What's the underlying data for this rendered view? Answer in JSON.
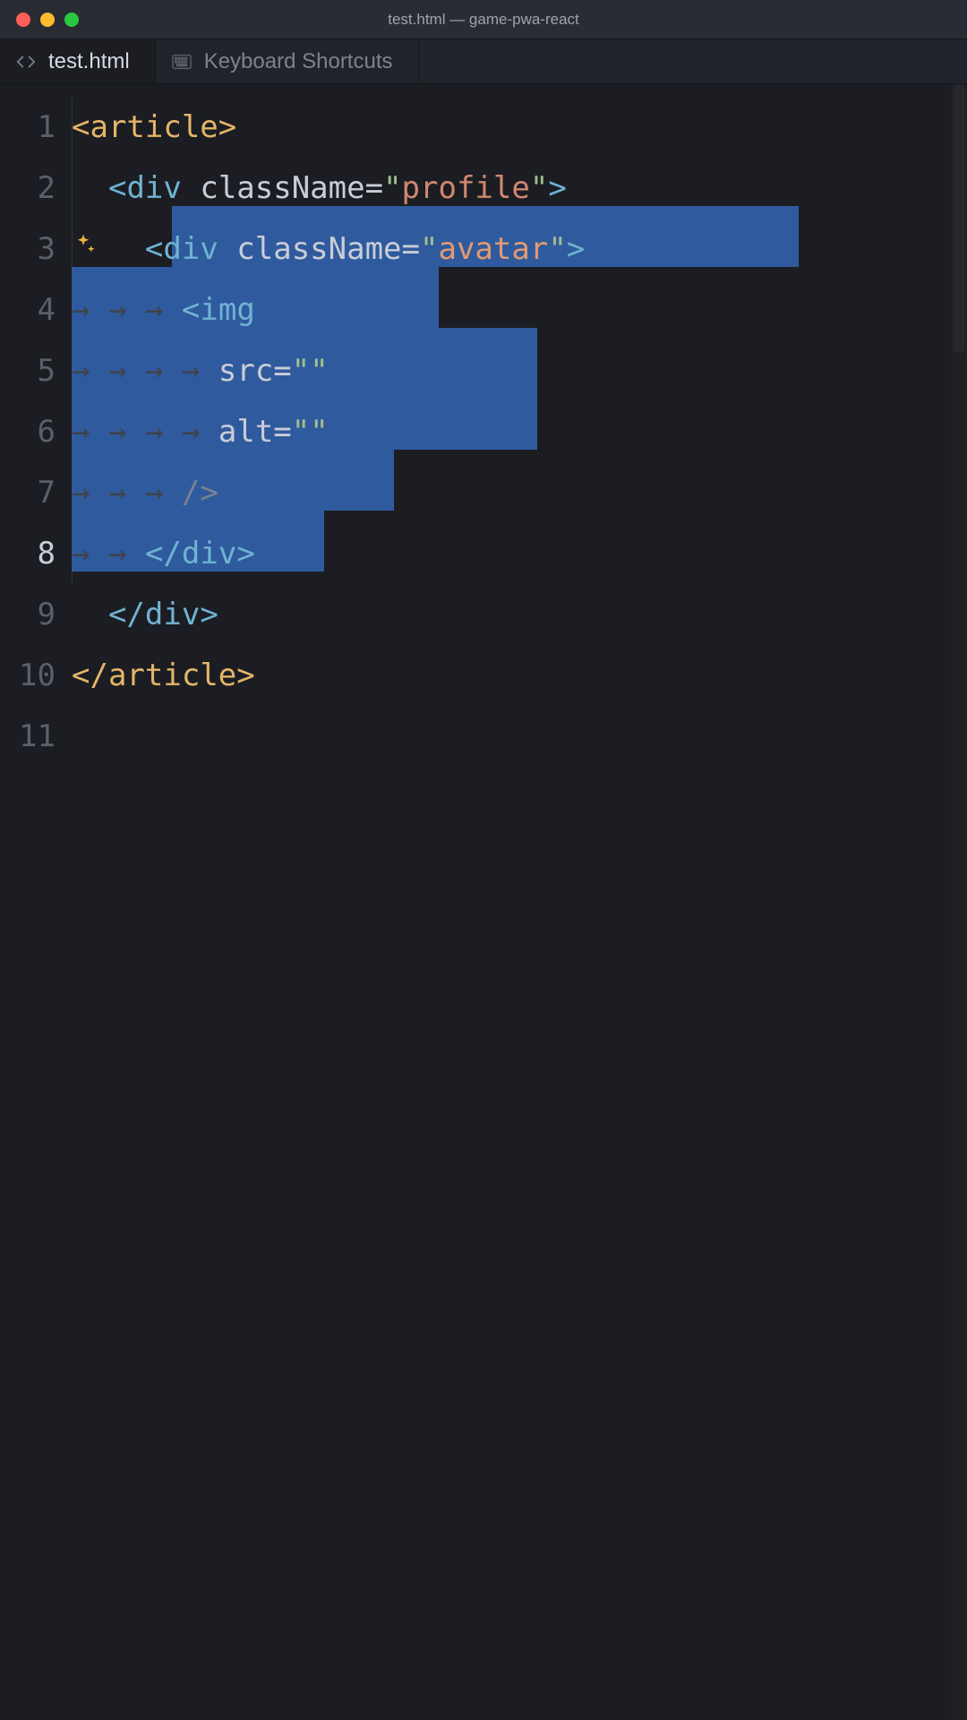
{
  "window": {
    "title": "test.html — game-pwa-react"
  },
  "tabs": [
    {
      "label": "test.html",
      "icon": "code-icon",
      "active": true
    },
    {
      "label": "Keyboard Shortcuts",
      "icon": "keyboard-icon",
      "active": false
    }
  ],
  "editor": {
    "lineCount": 11,
    "currentLine": 8,
    "lineNumbers": [
      "1",
      "2",
      "3",
      "4",
      "5",
      "6",
      "7",
      "8",
      "9",
      "10",
      "11"
    ],
    "code": {
      "line1": {
        "tag": "article"
      },
      "line2": {
        "tag": "div",
        "attr": "className",
        "value": "profile"
      },
      "line3": {
        "tag": "div",
        "attr": "className",
        "value": "avatar"
      },
      "line4": {
        "tag": "img"
      },
      "line5": {
        "attr": "src",
        "value": ""
      },
      "line6": {
        "attr": "alt",
        "value": ""
      },
      "line7": {
        "selfclose": "/>"
      },
      "line8": {
        "closetag": "div"
      },
      "line9": {
        "closetag": "div"
      },
      "line10": {
        "closetag": "article"
      }
    },
    "whitespaceGlyph": "→",
    "selection": {
      "startLine": 3,
      "endLine": 8
    }
  }
}
